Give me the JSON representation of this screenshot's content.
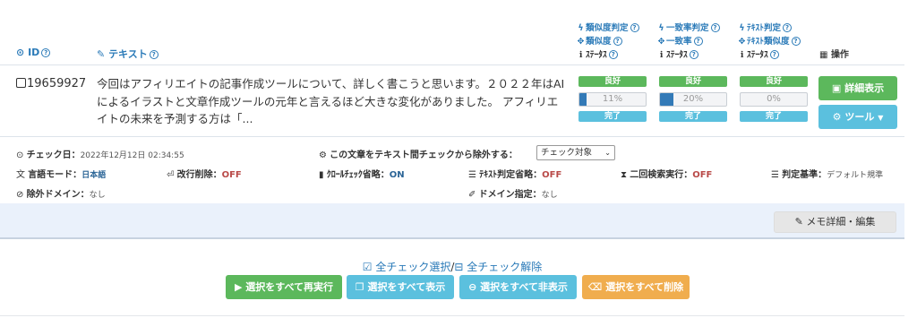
{
  "header": {
    "id_label": "ID",
    "text_label": "テキスト",
    "similarity_group": [
      "類似度判定",
      "類似度",
      "ｽﾃｰﾀｽ"
    ],
    "match_group": [
      "一致率判定",
      "一致率",
      "ｽﾃｰﾀｽ"
    ],
    "text_group": [
      "ﾃｷｽﾄ判定",
      "ﾃｷｽﾄ類似度",
      "ｽﾃｰﾀｽ"
    ],
    "ops_label": "操作"
  },
  "row": {
    "id": "19659927",
    "text": "今回はアフィリエイトの記事作成ツールについて、詳しく書こうと思います。２０２２年はAIによるイラストと文章作成ツールの元年と言えるほど大きな変化がありました。 アフィリエイトの未来を予測する方は「...",
    "similarity": {
      "status_top": "良好",
      "percent": "11%",
      "fill": 0.11,
      "status_bottom": "完了"
    },
    "match": {
      "status_top": "良好",
      "percent": "20%",
      "fill": 0.2,
      "status_bottom": "完了"
    },
    "textcheck": {
      "status_top": "良好",
      "percent": "0%",
      "fill": 0.0,
      "status_bottom": "完了"
    },
    "detail_button": "詳細表示",
    "tool_button": "ツール"
  },
  "meta": {
    "check_date_label": "チェック日：",
    "check_date_value": "2022年12月12日 02:34:55",
    "exclude_label": "この文章をテキスト間チェックから除外する：",
    "exclude_select": "チェック対象",
    "lang_label": "言語モード：",
    "lang_value": "日本語",
    "linebreak_label": "改行削除：",
    "linebreak_value": "OFF",
    "crawl_label": "ｸﾛｰﾙﾁｪｯｸ省略：",
    "crawl_value": "ON",
    "textjudge_label": "ﾃｷｽﾄ判定省略：",
    "textjudge_value": "OFF",
    "double_label": "二回検索実行：",
    "double_value": "OFF",
    "criteria_label": "判定基準：",
    "criteria_value": "デフォルト規準",
    "exdomain_label": "除外ドメイン：",
    "exdomain_value": "なし",
    "domain_label": "ドメイン指定：",
    "domain_value": "なし"
  },
  "memo_button": "メモ詳細・編集",
  "footer": {
    "select_all": "全チェック選択",
    "separator": "/",
    "deselect_all": "全チェック解除",
    "rerun": "選択をすべて再実行",
    "show": "選択をすべて表示",
    "hide": "選択をすべて非表示",
    "delete": "選択をすべて削除"
  },
  "colors": {
    "accent": "#2a7ab8",
    "good": "#5cb85c",
    "done": "#5bc0de",
    "warning": "#f0ad4e",
    "memo_band": "#eaf1fb"
  }
}
